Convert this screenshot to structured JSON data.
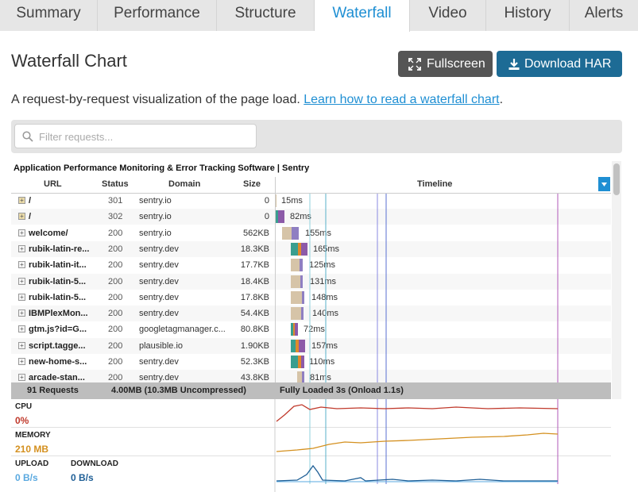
{
  "tabs": [
    {
      "label": "Summary",
      "active": false
    },
    {
      "label": "Performance",
      "active": false
    },
    {
      "label": "Structure",
      "active": false
    },
    {
      "label": "Waterfall",
      "active": true
    },
    {
      "label": "Video",
      "active": false
    },
    {
      "label": "History",
      "active": false
    },
    {
      "label": "Alerts",
      "active": false
    }
  ],
  "page": {
    "title": "Waterfall Chart",
    "fullscreen_label": "Fullscreen",
    "download_label": "Download HAR",
    "description": "A request-by-request visualization of the page load.",
    "learn_link": "Learn how to read a waterfall chart",
    "description_end": "."
  },
  "filter": {
    "placeholder": "Filter requests...",
    "value": ""
  },
  "waterfall": {
    "page_title": "Application Performance Monitoring & Error Tracking Software | Sentry",
    "headers": {
      "url": "URL",
      "status": "Status",
      "domain": "Domain",
      "size": "Size",
      "timeline": "Timeline"
    },
    "rows": [
      {
        "url": "/",
        "status": "301",
        "domain": "sentry.io",
        "size": "0",
        "duration": "15ms",
        "redirect": true
      },
      {
        "url": "/",
        "status": "302",
        "domain": "sentry.io",
        "size": "0",
        "duration": "82ms",
        "redirect": true
      },
      {
        "url": "welcome/",
        "status": "200",
        "domain": "sentry.io",
        "size": "562KB",
        "duration": "155ms",
        "redirect": false
      },
      {
        "url": "rubik-latin-re...",
        "status": "200",
        "domain": "sentry.dev",
        "size": "18.3KB",
        "duration": "165ms",
        "redirect": false
      },
      {
        "url": "rubik-latin-it...",
        "status": "200",
        "domain": "sentry.dev",
        "size": "17.7KB",
        "duration": "125ms",
        "redirect": false
      },
      {
        "url": "rubik-latin-5...",
        "status": "200",
        "domain": "sentry.dev",
        "size": "18.4KB",
        "duration": "131ms",
        "redirect": false
      },
      {
        "url": "rubik-latin-5...",
        "status": "200",
        "domain": "sentry.dev",
        "size": "17.8KB",
        "duration": "148ms",
        "redirect": false
      },
      {
        "url": "IBMPlexMon...",
        "status": "200",
        "domain": "sentry.dev",
        "size": "54.4KB",
        "duration": "140ms",
        "redirect": false
      },
      {
        "url": "gtm.js?id=G...",
        "status": "200",
        "domain": "googletagmanager.c...",
        "size": "80.8KB",
        "duration": "72ms",
        "redirect": false
      },
      {
        "url": "script.tagge...",
        "status": "200",
        "domain": "plausible.io",
        "size": "1.90KB",
        "duration": "157ms",
        "redirect": false
      },
      {
        "url": "new-home-s...",
        "status": "200",
        "domain": "sentry.dev",
        "size": "52.3KB",
        "duration": "110ms",
        "redirect": false
      },
      {
        "url": "arcade-stan...",
        "status": "200",
        "domain": "sentry.dev",
        "size": "43.8KB",
        "duration": "81ms",
        "redirect": false
      }
    ],
    "summary": {
      "requests": "91 Requests",
      "size": "4.00MB  (10.3MB Uncompressed)",
      "loaded": "Fully Loaded 3s  (Onload 1.1s)"
    }
  },
  "metrics": {
    "cpu": {
      "label": "CPU",
      "value": "0%",
      "color": "#c0392b"
    },
    "memory": {
      "label": "MEMORY",
      "value": "210 MB",
      "color": "#d4901f"
    },
    "upload": {
      "label": "UPLOAD",
      "value": "0 B/s",
      "color": "#5aa9e0"
    },
    "download": {
      "label": "DOWNLOAD",
      "value": "0 B/s",
      "color": "#1f5f96"
    }
  },
  "colors": {
    "accent": "#1f8fd3",
    "har_button": "#1d6b95",
    "fullscreen_button": "#555555",
    "dns": "#3a9e8f",
    "connect": "#e08a2b",
    "ssl": "#8c5aa8",
    "wait": "#d6c4a8",
    "receive": "#8f7fc2"
  }
}
